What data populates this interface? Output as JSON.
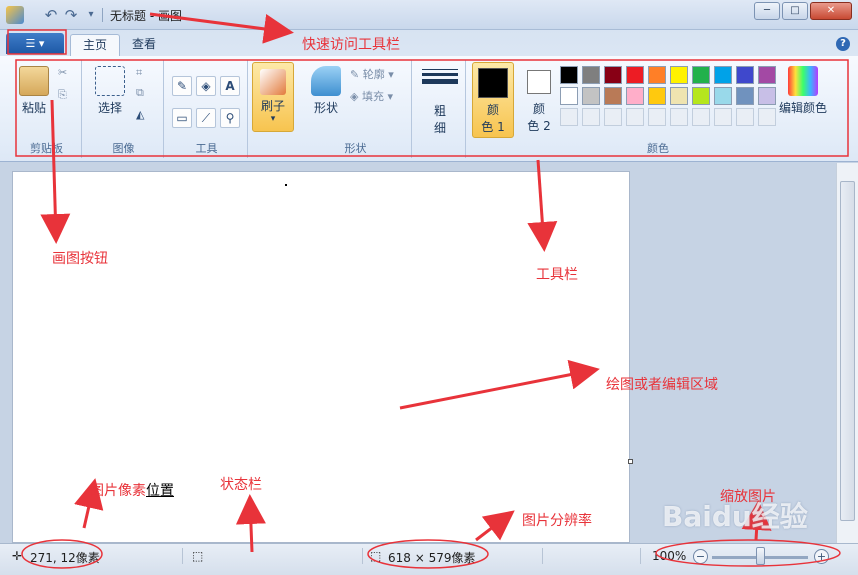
{
  "titlebar": {
    "title": "无标题 - 画图",
    "undo_icon": "undo-icon",
    "redo_icon": "redo-icon",
    "customize_icon": "chevron-down-icon",
    "minimize": "─",
    "maximize": "□",
    "close": "✕"
  },
  "tabs": {
    "app_menu_icon": "menu-icon",
    "items": [
      "主页",
      "查看"
    ],
    "active": "主页",
    "help": "?"
  },
  "ribbon": {
    "clipboard": {
      "paste_label": "粘贴",
      "group_label": "剪贴板"
    },
    "image": {
      "select_label": "选择",
      "group_label": "图像"
    },
    "tools": {
      "text_tool": "A",
      "group_label": "工具"
    },
    "brush": {
      "label": "刷子"
    },
    "shapes": {
      "shapes_label": "形状",
      "outline_label": "轮廓",
      "fill_label": "填充",
      "group_label": "形状"
    },
    "size": {
      "label_line1": "粗",
      "label_line2": "细"
    },
    "colors": {
      "color1_line1": "颜",
      "color1_line2": "色 1",
      "color2_line1": "颜",
      "color2_line2": "色 2",
      "edit_label": "编辑颜色",
      "group_label": "颜色",
      "color1": "#000000",
      "color2": "#ffffff",
      "palette_row1": [
        "#000000",
        "#7f7f7f",
        "#880015",
        "#ed1c24",
        "#ff7f27",
        "#fff200",
        "#22b14c",
        "#00a2e8",
        "#3f48cc",
        "#a349a4"
      ],
      "palette_row2": [
        "#ffffff",
        "#c3c3c3",
        "#b97a57",
        "#ffaec9",
        "#ffc90e",
        "#efe4b0",
        "#b5e61d",
        "#99d9ea",
        "#7092be",
        "#c8bfe7"
      ]
    }
  },
  "statusbar": {
    "cursor_position": "271, 12像素",
    "image_size": "618 × 579像素",
    "zoom": "100%",
    "zoom_out": "−",
    "zoom_in": "+"
  },
  "annotations": {
    "quick_access": "快速访问工具栏",
    "paint_button": "画图按钮",
    "toolbar": "工具栏",
    "drawing_area": "绘图或者编辑区域",
    "pixel_position_a": "图片像素",
    "pixel_position_b": "位置",
    "status_bar": "状态栏",
    "resolution": "图片分辨率",
    "zoom_image": "缩放图片"
  },
  "watermark": "Baidu经验",
  "accent": "#e8333a"
}
